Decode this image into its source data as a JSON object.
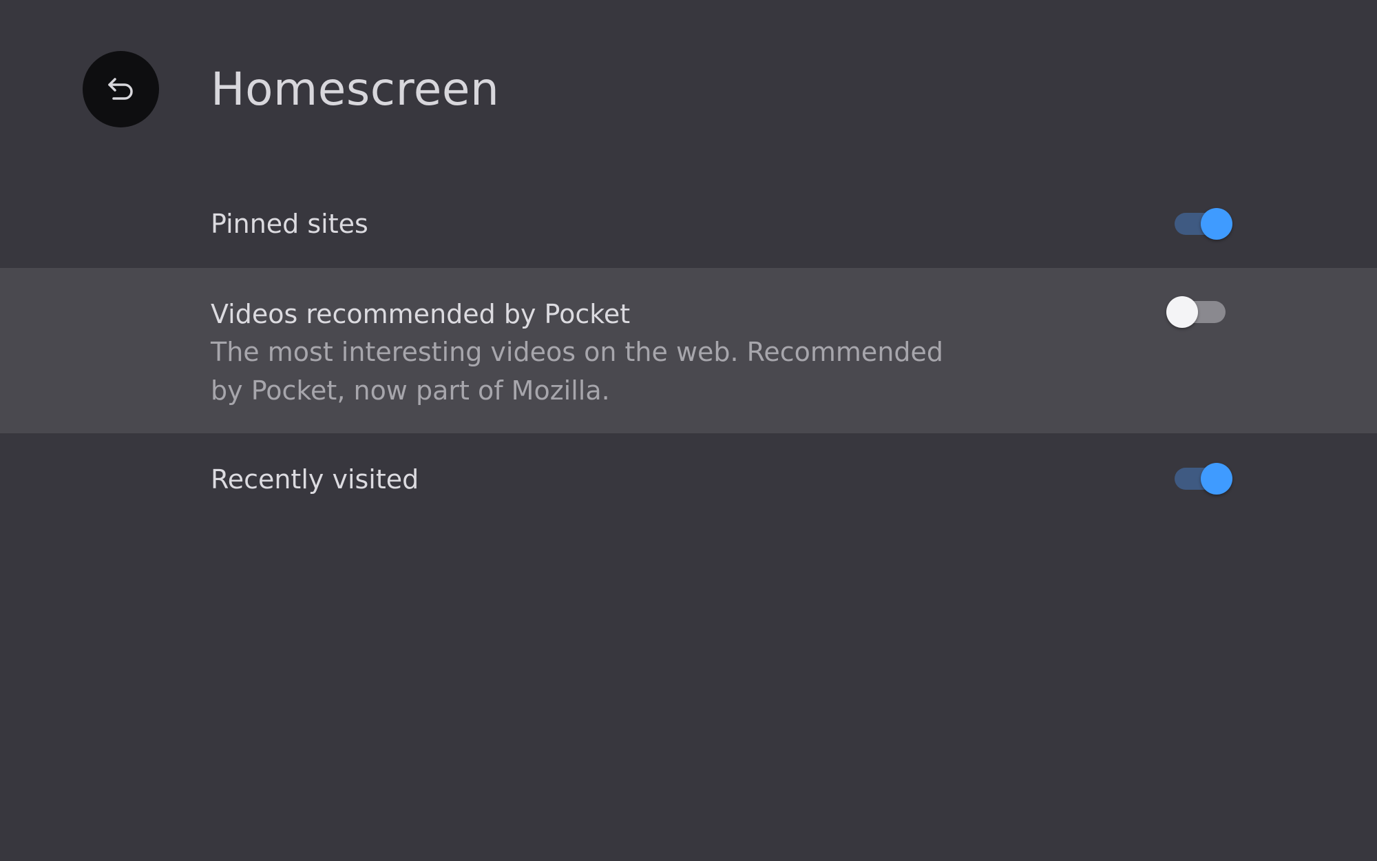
{
  "header": {
    "back_icon": "back-arrow-icon",
    "title": "Homescreen"
  },
  "settings": [
    {
      "label": "Pinned sites",
      "description": "",
      "enabled": true
    },
    {
      "label": "Videos recommended by Pocket",
      "description_line1": "The most interesting videos on the web. Recommended",
      "description_line2": "by Pocket, now part of Mozilla.",
      "enabled": false
    },
    {
      "label": "Recently visited",
      "description": "",
      "enabled": true
    }
  ],
  "colors": {
    "background": "#38373e",
    "highlight_row": "#4a494f",
    "toggle_on_thumb": "#3f9bff",
    "toggle_on_track": "#3f5a82",
    "toggle_off_thumb": "#f4f4f6",
    "toggle_off_track": "#8a898f"
  }
}
